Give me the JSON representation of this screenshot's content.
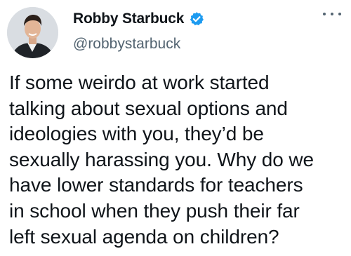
{
  "author": {
    "display_name": "Robby Starbuck",
    "handle": "@robbystarbuck",
    "verified": true,
    "verified_icon": "verified-badge-icon",
    "avatar_icon": "profile-photo"
  },
  "tweet": {
    "lines": [
      "If some weirdo at work started",
      "talking about sexual options and",
      "ideologies with you, they’d be",
      "sexually harassing you. Why do we",
      "have lower standards for teachers",
      "in school when they push their far",
      "left sexual agenda on children?"
    ]
  },
  "colors": {
    "verified_blue": "#1d9bf0",
    "text_primary": "#0f1419",
    "text_secondary": "#536471"
  },
  "menu": {
    "icon": "more-options-icon"
  }
}
